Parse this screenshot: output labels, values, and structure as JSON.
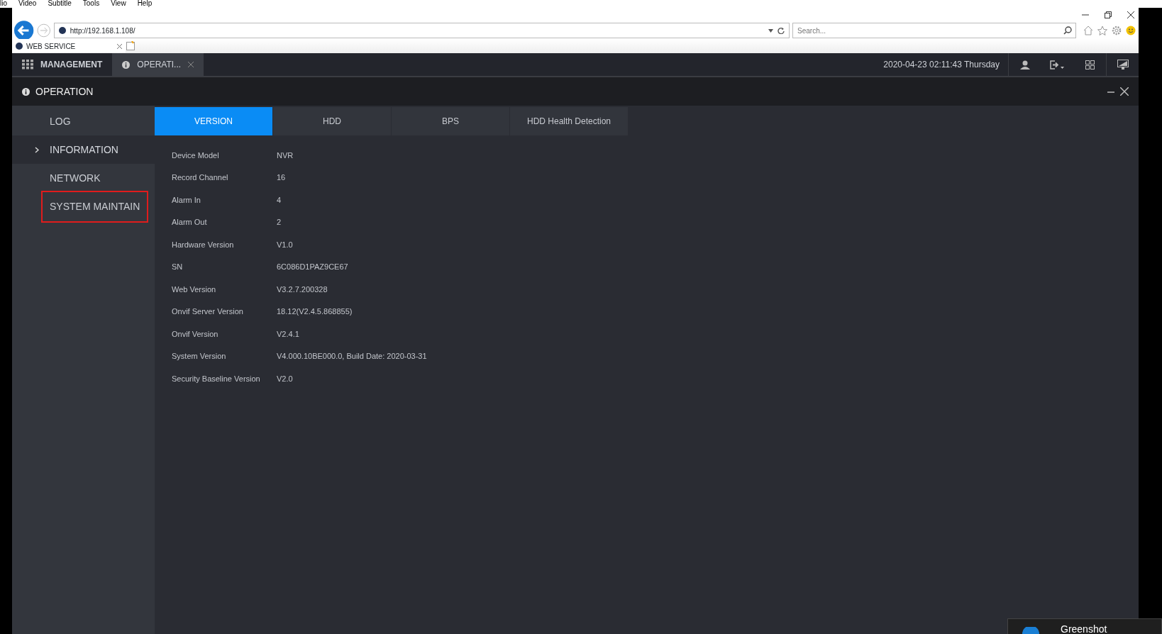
{
  "menu_bar": [
    "lio",
    "Video",
    "Subtitle",
    "Tools",
    "View",
    "Help"
  ],
  "browser": {
    "url": "http://192.168.1.108/",
    "search_placeholder": "Search...",
    "tab_title": "WEB SERVICE"
  },
  "app_header": {
    "tabs": [
      {
        "label": "MANAGEMENT",
        "kind": "home",
        "selected": false
      },
      {
        "label": "OPERATI...",
        "kind": "page",
        "selected": true
      }
    ],
    "datetime": "2020-04-23 02:11:43 Thursday"
  },
  "panel": {
    "title": "OPERATION"
  },
  "sidebar": {
    "items": [
      {
        "label": "LOG",
        "selected": false,
        "outlined": false
      },
      {
        "label": "INFORMATION",
        "selected": true,
        "outlined": false
      },
      {
        "label": "NETWORK",
        "selected": false,
        "outlined": false
      },
      {
        "label": "SYSTEM MAINTAIN",
        "selected": false,
        "outlined": true
      }
    ]
  },
  "tabs": [
    {
      "label": "VERSION",
      "selected": true
    },
    {
      "label": "HDD",
      "selected": false
    },
    {
      "label": "BPS",
      "selected": false
    },
    {
      "label": "HDD Health Detection",
      "selected": false
    }
  ],
  "info": [
    {
      "label": "Device Model",
      "value": "NVR"
    },
    {
      "label": "Record Channel",
      "value": "16"
    },
    {
      "label": "Alarm In",
      "value": "4"
    },
    {
      "label": "Alarm Out",
      "value": "2"
    },
    {
      "label": "Hardware Version",
      "value": "V1.0"
    },
    {
      "label": "SN",
      "value": "6C086D1PAZ9CE67"
    },
    {
      "label": "Web Version",
      "value": "V3.2.7.200328"
    },
    {
      "label": "Onvif Server Version",
      "value": "18.12(V2.4.5.868855)"
    },
    {
      "label": "Onvif Version",
      "value": "V2.4.1"
    },
    {
      "label": "System Version",
      "value": "V4.000.10BE000.0, Build Date: 2020-03-31"
    },
    {
      "label": "Security Baseline Version",
      "value": "V2.0"
    }
  ],
  "notification": {
    "title": "Greenshot"
  }
}
